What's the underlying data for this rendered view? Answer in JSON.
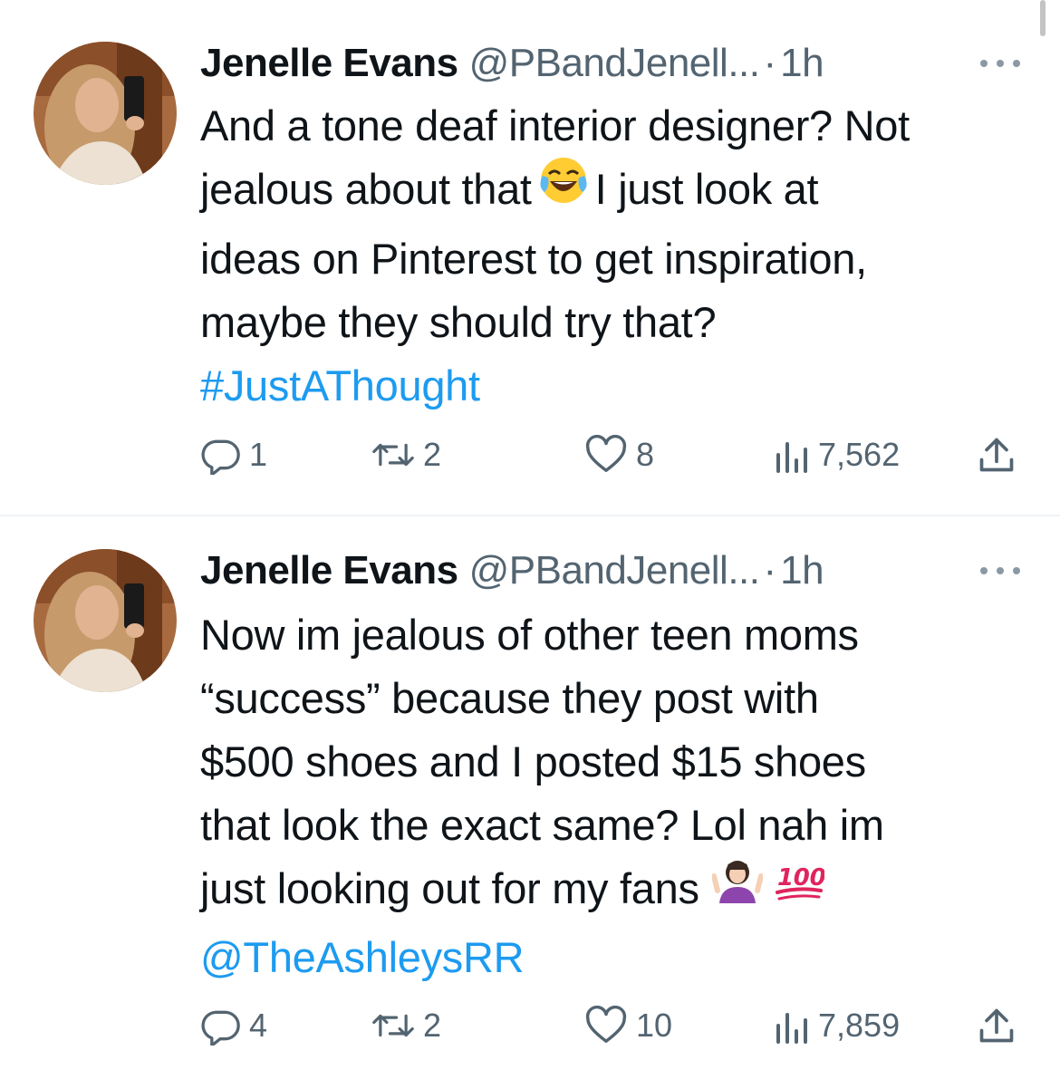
{
  "tweets": [
    {
      "name": "Jenelle Evans",
      "handle": "@PBandJenell...",
      "separator": "·",
      "time": "1h",
      "lines": [
        "And a tone deaf interior designer? Not",
        "jealous about that",
        "I just look at",
        "ideas on Pinterest to get inspiration,",
        "maybe they should try that?"
      ],
      "emoji": "face-with-tears-of-joy",
      "link": "#JustAThought",
      "stats": {
        "replies": "1",
        "retweets": "2",
        "likes": "8",
        "views": "7,562"
      }
    },
    {
      "name": "Jenelle Evans",
      "handle": "@PBandJenell...",
      "separator": "·",
      "time": "1h",
      "lines": [
        "Now im jealous of other teen moms",
        "“success” because they post with",
        "$500 shoes and I posted $15 shoes",
        "that look the exact same? Lol nah im",
        "just looking out for my fans"
      ],
      "emojis": [
        "woman-shrugging",
        "hundred-points"
      ],
      "emoji_text": "100",
      "link": "@TheAshleysRR",
      "stats": {
        "replies": "4",
        "retweets": "2",
        "likes": "10",
        "views": "7,859"
      }
    }
  ],
  "colors": {
    "text": "#0f1419",
    "muted": "#536471",
    "link": "#1d9bf0",
    "divider": "#eff3f4"
  }
}
